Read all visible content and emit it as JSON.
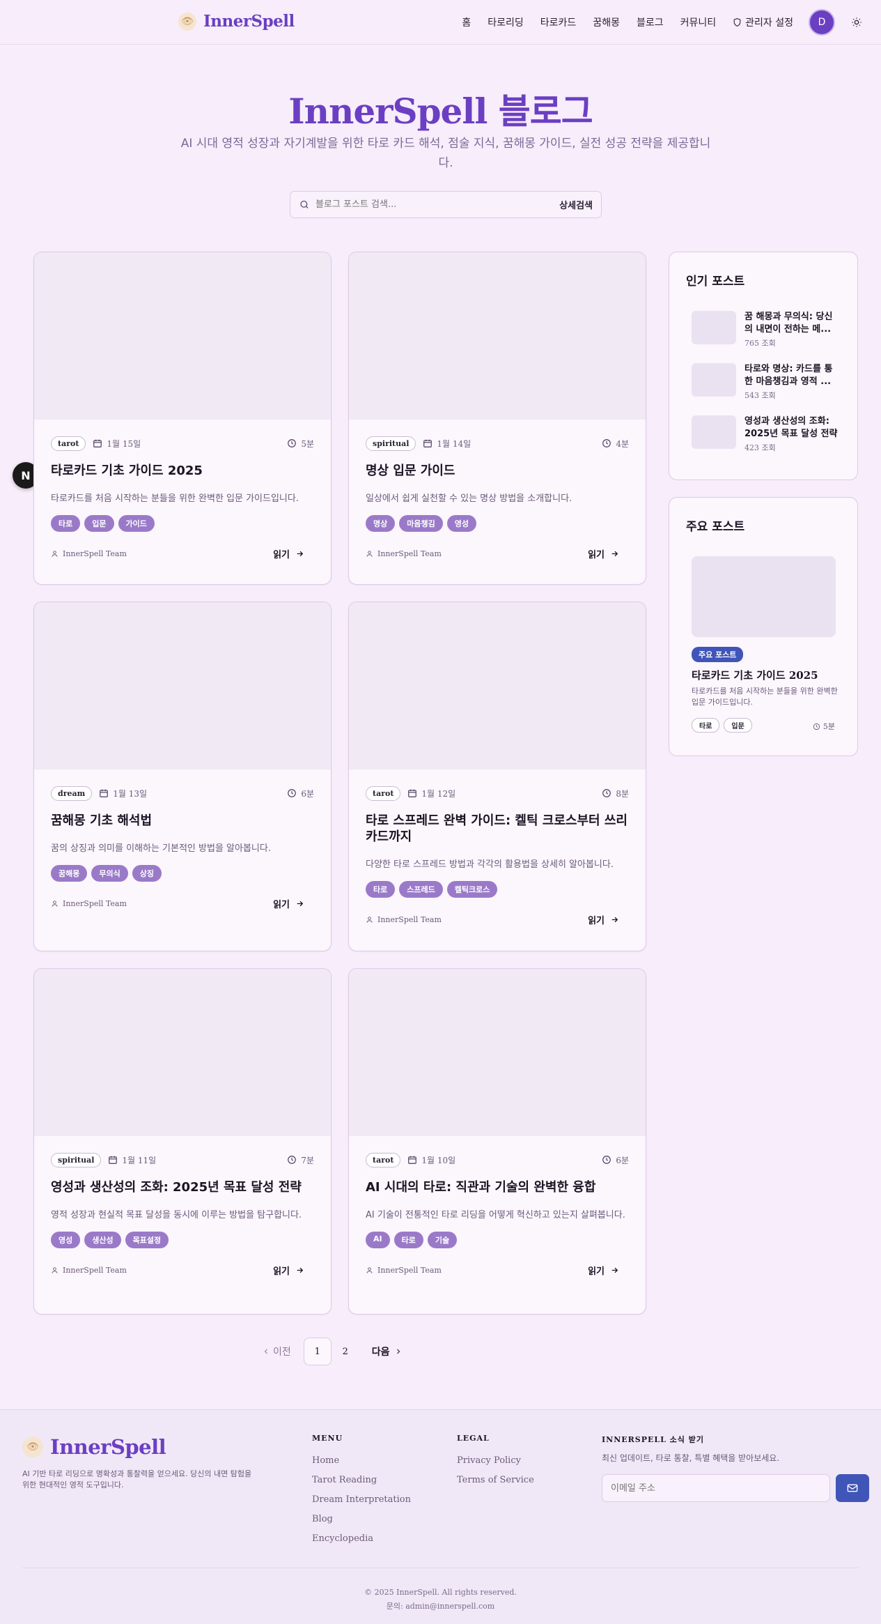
{
  "header": {
    "logo": "InnerSpell",
    "nav": [
      "홈",
      "타로리딩",
      "타로카드",
      "꿈해몽",
      "블로그",
      "커뮤니티"
    ],
    "admin": "관리자 설정",
    "avatar_initial": "D"
  },
  "hero": {
    "title": "InnerSpell 블로그",
    "subtitle": "AI 시대 영적 성장과 자기계발을 위한 타로 카드 해석, 점술 지식, 꿈해몽 가이드, 실전 성공 전략을 제공합니다.",
    "search_placeholder": "블로그 포스트 검색...",
    "advanced_search": "상세검색"
  },
  "posts": [
    {
      "category": "tarot",
      "date": "1월 15일",
      "read_time": "5분",
      "title": "타로카드 기초 가이드 2025",
      "excerpt": "타로카드를 처음 시작하는 분들을 위한 완벽한 입문 가이드입니다.",
      "tags": [
        "타로",
        "입문",
        "가이드"
      ],
      "author": "InnerSpell Team",
      "read_label": "읽기"
    },
    {
      "category": "spiritual",
      "date": "1월 14일",
      "read_time": "4분",
      "title": "명상 입문 가이드",
      "excerpt": "일상에서 쉽게 실천할 수 있는 명상 방법을 소개합니다.",
      "tags": [
        "명상",
        "마음챙김",
        "영성"
      ],
      "author": "InnerSpell Team",
      "read_label": "읽기"
    },
    {
      "category": "dream",
      "date": "1월 13일",
      "read_time": "6분",
      "title": "꿈해몽 기초 해석법",
      "excerpt": "꿈의 상징과 의미를 이해하는 기본적인 방법을 알아봅니다.",
      "tags": [
        "꿈해몽",
        "무의식",
        "상징"
      ],
      "author": "InnerSpell Team",
      "read_label": "읽기"
    },
    {
      "category": "tarot",
      "date": "1월 12일",
      "read_time": "8분",
      "title": "타로 스프레드 완벽 가이드: 켈틱 크로스부터 쓰리 카드까지",
      "excerpt": "다양한 타로 스프레드 방법과 각각의 활용법을 상세히 알아봅니다.",
      "tags": [
        "타로",
        "스프레드",
        "켈틱크로스"
      ],
      "author": "InnerSpell Team",
      "read_label": "읽기"
    },
    {
      "category": "spiritual",
      "date": "1월 11일",
      "read_time": "7분",
      "title": "영성과 생산성의 조화: 2025년 목표 달성 전략",
      "excerpt": "영적 성장과 현실적 목표 달성을 동시에 이루는 방법을 탐구합니다.",
      "tags": [
        "영성",
        "생산성",
        "목표설정"
      ],
      "author": "InnerSpell Team",
      "read_label": "읽기"
    },
    {
      "category": "tarot",
      "date": "1월 10일",
      "read_time": "6분",
      "title": "AI 시대의 타로: 직관과 기술의 완벽한 융합",
      "excerpt": "AI 기술이 전통적인 타로 리딩을 어떻게 혁신하고 있는지 살펴봅니다.",
      "tags": [
        "AI",
        "타로",
        "기술"
      ],
      "author": "InnerSpell Team",
      "read_label": "읽기"
    }
  ],
  "sidebar": {
    "popular_title": "인기 포스트",
    "popular": [
      {
        "title": "꿈 해몽과 무의식: 당신의 내면이 전하는 메...",
        "views": "765 조회"
      },
      {
        "title": "타로와 명상: 카드를 통한 마음챙김과 영적 ...",
        "views": "543 조회"
      },
      {
        "title": "영성과 생산성의 조화: 2025년 목표 달성 전략",
        "views": "423 조회"
      }
    ],
    "featured_title": "주요 포스트",
    "featured": {
      "badge": "주요 포스트",
      "title": "타로카드 기초 가이드 2025",
      "excerpt": "타로카드를 처음 시작하는 분들을 위한 완벽한 입문 가이드입니다.",
      "tags": [
        "타로",
        "입문"
      ],
      "read_time": "5분"
    }
  },
  "pagination": {
    "prev": "이전",
    "pages": [
      "1",
      "2"
    ],
    "next": "다음",
    "current": "1"
  },
  "floating_badge": "N",
  "footer": {
    "logo": "InnerSpell",
    "description": "AI 기반 타로 리딩으로 명확성과 통찰력을 얻으세요. 당신의 내면 탐험을 위한 현대적인 영적 도구입니다.",
    "menu_title": "MENU",
    "menu": [
      "Home",
      "Tarot Reading",
      "Dream Interpretation",
      "Blog",
      "Encyclopedia"
    ],
    "legal_title": "LEGAL",
    "legal": [
      "Privacy Policy",
      "Terms of Service"
    ],
    "newsletter_title": "INNERSPELL 소식 받기",
    "newsletter_desc": "최신 업데이트, 타로 통찰, 특별 혜택을 받아보세요.",
    "email_placeholder": "이메일 주소",
    "copyright": "© 2025 InnerSpell. All rights reserved.",
    "contact": "문의: admin@innerspell.com"
  },
  "colors": {
    "brand": "#6b3fc2",
    "tag": "#9a7ac8",
    "featured_badge": "#3f55b8"
  }
}
